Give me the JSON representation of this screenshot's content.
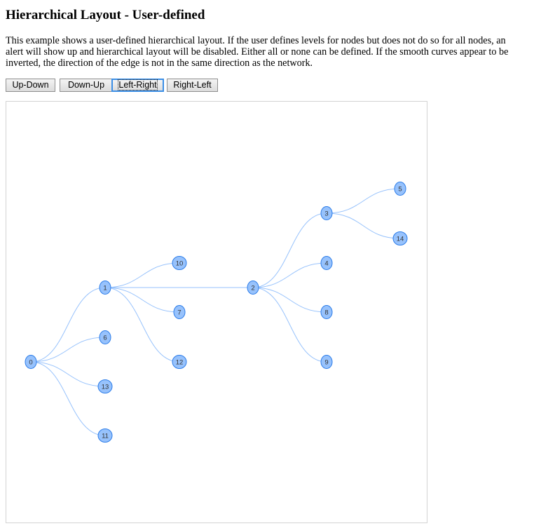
{
  "page": {
    "title": "Hierarchical Layout - User-defined",
    "description": "This example shows a user-defined hierarchical layout. If the user defines levels for nodes but does not do so for all nodes, an alert will show up and hierarchical layout will be disabled. Either all or none can be defined. If the smooth curves appear to be inverted, the direction of the edge is not in the same direction as the network."
  },
  "buttons": [
    {
      "label": "Up-Down",
      "focused": false
    },
    {
      "label": "Down-Up",
      "focused": false
    },
    {
      "label": "Left-Right",
      "focused": true
    },
    {
      "label": "Right-Left",
      "focused": false
    }
  ],
  "network": {
    "direction": "Left-Right",
    "colors": {
      "node_fill": "#97c2fc",
      "node_border": "#2b7ce9",
      "edge": "#97c2fc",
      "label": "#343434"
    },
    "nodes": [
      {
        "id": "0",
        "level": 0
      },
      {
        "id": "1",
        "level": 1
      },
      {
        "id": "6",
        "level": 1
      },
      {
        "id": "13",
        "level": 1
      },
      {
        "id": "11",
        "level": 1
      },
      {
        "id": "10",
        "level": 2
      },
      {
        "id": "7",
        "level": 2
      },
      {
        "id": "12",
        "level": 2
      },
      {
        "id": "2",
        "level": 3
      },
      {
        "id": "3",
        "level": 4
      },
      {
        "id": "4",
        "level": 4
      },
      {
        "id": "8",
        "level": 4
      },
      {
        "id": "9",
        "level": 4
      },
      {
        "id": "5",
        "level": 5
      },
      {
        "id": "14",
        "level": 5
      }
    ],
    "edges": [
      {
        "from": "0",
        "to": "1"
      },
      {
        "from": "0",
        "to": "6"
      },
      {
        "from": "0",
        "to": "13"
      },
      {
        "from": "0",
        "to": "11"
      },
      {
        "from": "1",
        "to": "2"
      },
      {
        "from": "1",
        "to": "10"
      },
      {
        "from": "1",
        "to": "7"
      },
      {
        "from": "1",
        "to": "12"
      },
      {
        "from": "2",
        "to": "3"
      },
      {
        "from": "2",
        "to": "4"
      },
      {
        "from": "2",
        "to": "8"
      },
      {
        "from": "2",
        "to": "9"
      },
      {
        "from": "3",
        "to": "5"
      },
      {
        "from": "3",
        "to": "14"
      }
    ]
  }
}
